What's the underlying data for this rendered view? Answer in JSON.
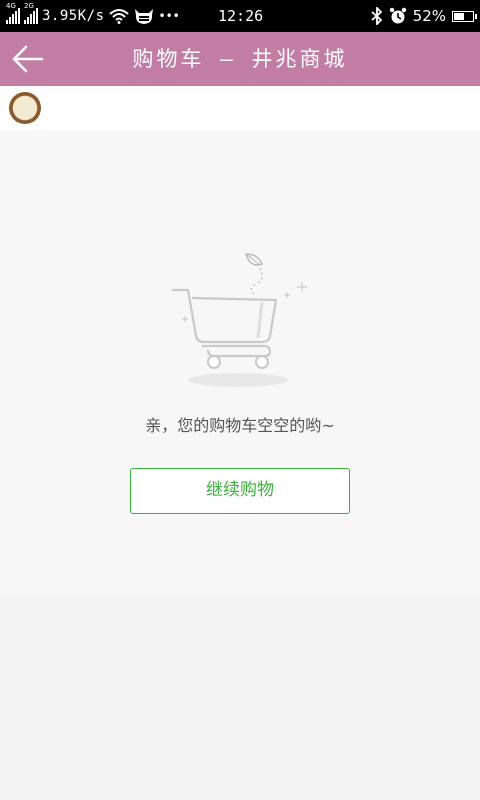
{
  "status_bar": {
    "net1": "4G",
    "net2": "2G",
    "speed": "3.95K/s",
    "dots": "•••",
    "time": "12:26",
    "battery": "52%",
    "battery_level": 0.52
  },
  "header": {
    "title": "购物车 — 井兆商城"
  },
  "empty_state": {
    "message": "亲，您的购物车空空的哟~",
    "button_label": "继续购物"
  }
}
